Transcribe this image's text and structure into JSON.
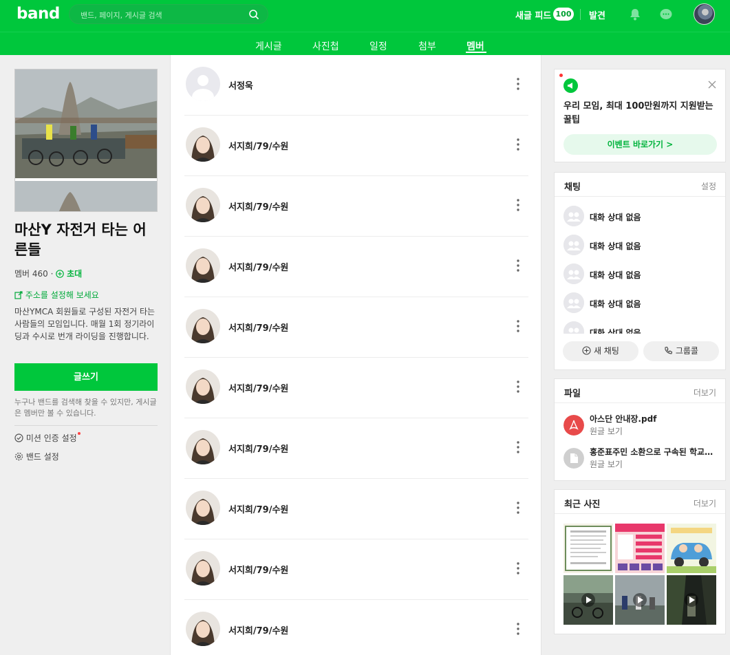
{
  "topbar": {
    "logo": "band",
    "search_placeholder": "밴드, 페이지, 게시글 검색",
    "feed_label": "새글 피드",
    "feed_count": "100",
    "discover_label": "발견"
  },
  "tabs": [
    {
      "label": "게시글"
    },
    {
      "label": "사진첩"
    },
    {
      "label": "일정"
    },
    {
      "label": "첨부"
    },
    {
      "label": "멤버",
      "active": true
    }
  ],
  "band": {
    "title": "마산Y 자전거 타는 어른들",
    "member_label": "멤버 460",
    "dot": "·",
    "invite_label": "초대",
    "address_link": "주소를 설정해 보세요",
    "description": "마산YMCA 회원들로 구성된 자전거 타는 사람들의 모임입니다. 매월 1회 정기라이딩과 수시로 번개 라이딩을 진행합니다.",
    "write_button": "글쓰기",
    "visibility_note": "누구나 밴드를 검색해 찾을 수 있지만, 게시글은 멤버만 볼 수 있습니다.",
    "mission_setting": "미션 인증 설정",
    "band_setting": "밴드 설정"
  },
  "members": [
    {
      "name": "서정욱",
      "avatar": "default"
    },
    {
      "name": "서지희/79/수원",
      "avatar": "photo"
    },
    {
      "name": "서지희/79/수원",
      "avatar": "photo"
    },
    {
      "name": "서지희/79/수원",
      "avatar": "photo"
    },
    {
      "name": "서지희/79/수원",
      "avatar": "photo"
    },
    {
      "name": "서지희/79/수원",
      "avatar": "photo"
    },
    {
      "name": "서지희/79/수원",
      "avatar": "photo"
    },
    {
      "name": "서지희/79/수원",
      "avatar": "photo"
    },
    {
      "name": "서지희/79/수원",
      "avatar": "photo"
    },
    {
      "name": "서지희/79/수원",
      "avatar": "photo"
    }
  ],
  "event": {
    "title": "우리 모임, 최대 100만원까지 지원받는 꿀팁",
    "button": "이벤트 바로가기 >"
  },
  "chat": {
    "heading": "채팅",
    "settings": "설정",
    "rooms": [
      "대화 상대 없음",
      "대화 상대 없음",
      "대화 상대 없음",
      "대화 상대 없음",
      "대화 상대 없음"
    ],
    "new_chat": "새 채팅",
    "group_call": "그룹콜"
  },
  "files": {
    "heading": "파일",
    "more": "더보기",
    "items": [
      {
        "name": "아스단 안내장.pdf",
        "sub": "원글 보기",
        "type": "pdf"
      },
      {
        "name": "홍준표주민 소환으로 구속된 학교급식 살리기",
        "sub": "원글 보기",
        "type": "doc"
      }
    ]
  },
  "photos": {
    "heading": "최근 사진",
    "more": "더보기"
  },
  "colors": {
    "brand": "#00c73c",
    "pdf": "#e84a4a"
  }
}
